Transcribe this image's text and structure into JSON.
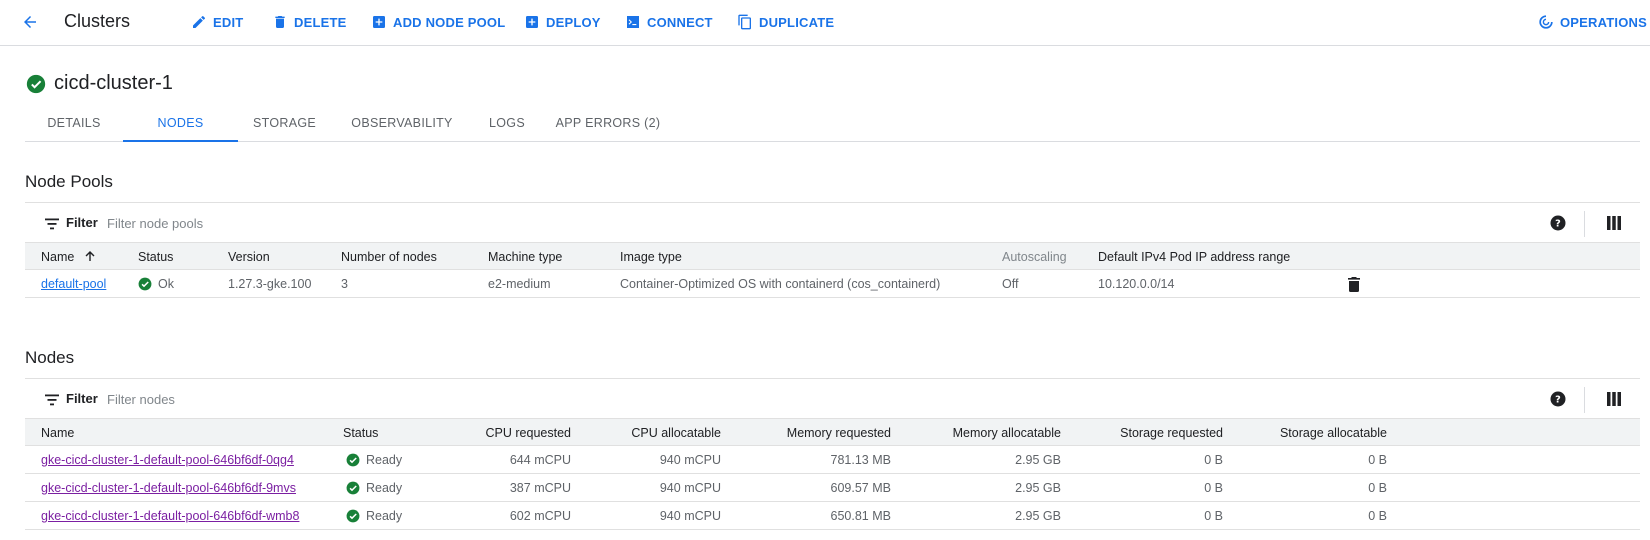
{
  "toolbar": {
    "title": "Clusters",
    "actions": [
      {
        "label": "EDIT",
        "icon": "pencil-icon"
      },
      {
        "label": "DELETE",
        "icon": "trash-icon"
      },
      {
        "label": "ADD NODE POOL",
        "icon": "add-box-icon"
      },
      {
        "label": "DEPLOY",
        "icon": "add-box-icon"
      },
      {
        "label": "CONNECT",
        "icon": "terminal-icon"
      },
      {
        "label": "DUPLICATE",
        "icon": "copy-icon"
      }
    ],
    "operations_label": "OPERATIONS"
  },
  "cluster": {
    "name": "cicd-cluster-1",
    "status_icon": "check-circle-icon",
    "status_color": "#188038"
  },
  "tabs": [
    {
      "label": "DETAILS",
      "active": false
    },
    {
      "label": "NODES",
      "active": true
    },
    {
      "label": "STORAGE",
      "active": false
    },
    {
      "label": "OBSERVABILITY",
      "active": false
    },
    {
      "label": "LOGS",
      "active": false
    },
    {
      "label": "APP ERRORS (2)",
      "active": false
    }
  ],
  "node_pools": {
    "title": "Node Pools",
    "filter_label": "Filter",
    "filter_placeholder": "Filter node pools",
    "columns": [
      "Name",
      "Status",
      "Version",
      "Number of nodes",
      "Machine type",
      "Image type",
      "Autoscaling",
      "Default IPv4 Pod IP address range"
    ],
    "rows": [
      {
        "name": "default-pool",
        "status": "Ok",
        "version": "1.27.3-gke.100",
        "nodes": "3",
        "machine_type": "e2-medium",
        "image_type": "Container-Optimized OS with containerd (cos_containerd)",
        "autoscaling": "Off",
        "ip_range": "10.120.0.0/14"
      }
    ]
  },
  "nodes": {
    "title": "Nodes",
    "filter_label": "Filter",
    "filter_placeholder": "Filter nodes",
    "columns": [
      "Name",
      "Status",
      "CPU requested",
      "CPU allocatable",
      "Memory requested",
      "Memory allocatable",
      "Storage requested",
      "Storage allocatable"
    ],
    "rows": [
      {
        "name": "gke-cicd-cluster-1-default-pool-646bf6df-0qg4",
        "status": "Ready",
        "cpu_req": "644 mCPU",
        "cpu_alloc": "940 mCPU",
        "mem_req": "781.13 MB",
        "mem_alloc": "2.95 GB",
        "sto_req": "0 B",
        "sto_alloc": "0 B"
      },
      {
        "name": "gke-cicd-cluster-1-default-pool-646bf6df-9mvs",
        "status": "Ready",
        "cpu_req": "387 mCPU",
        "cpu_alloc": "940 mCPU",
        "mem_req": "609.57 MB",
        "mem_alloc": "2.95 GB",
        "sto_req": "0 B",
        "sto_alloc": "0 B"
      },
      {
        "name": "gke-cicd-cluster-1-default-pool-646bf6df-wmb8",
        "status": "Ready",
        "cpu_req": "602 mCPU",
        "cpu_alloc": "940 mCPU",
        "mem_req": "650.81 MB",
        "mem_alloc": "2.95 GB",
        "sto_req": "0 B",
        "sto_alloc": "0 B"
      }
    ]
  },
  "colors": {
    "accent": "#1a73e8",
    "ok": "#188038",
    "visited_link": "#7b1fa2"
  }
}
